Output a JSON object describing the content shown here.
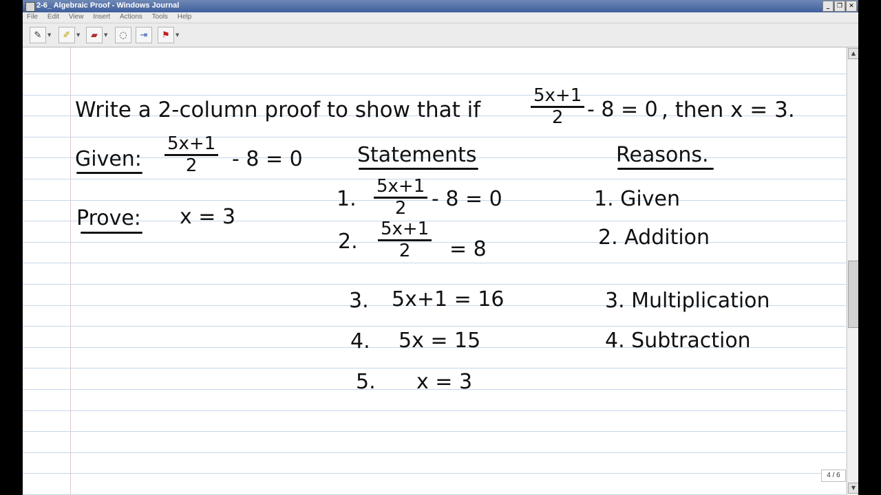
{
  "window": {
    "title": "2-6_ Algebraic Proof - Windows Journal",
    "minimize": "_",
    "restore": "❐",
    "close": "✕"
  },
  "menu": [
    "File",
    "Edit",
    "View",
    "Insert",
    "Actions",
    "Tools",
    "Help"
  ],
  "toolbar": {
    "tools": [
      {
        "name": "pen-tool",
        "glyph": "✎"
      },
      {
        "name": "highlighter-tool",
        "glyph": "✐"
      },
      {
        "name": "eraser-tool",
        "glyph": "▰"
      },
      {
        "name": "lasso-select-tool",
        "glyph": "◌"
      },
      {
        "name": "insert-space-tool",
        "glyph": "⇥"
      },
      {
        "name": "flag-tool",
        "glyph": "⚑"
      }
    ]
  },
  "note": {
    "heading": {
      "prefix": "Write a 2-column proof to show that if",
      "frac_num": "5x+1",
      "frac_den": "2",
      "frac_rest": "- 8 = 0",
      "suffix": ", then x = 3."
    },
    "given": {
      "label": "Given:",
      "frac_num": "5x+1",
      "frac_den": "2",
      "rest": "- 8 = 0"
    },
    "prove": {
      "label": "Prove:",
      "value": "x = 3"
    },
    "statements_header": "Statements",
    "reasons_header": "Reasons.",
    "rows": [
      {
        "num": "1.",
        "frac_num": "5x+1",
        "frac_den": "2",
        "rest": "- 8 = 0",
        "reason": "1. Given"
      },
      {
        "num": "2.",
        "frac_num": "5x+1",
        "frac_den": "2",
        "rest": "= 8",
        "reason": "2. Addition"
      },
      {
        "num": "3.",
        "statement": "5x+1 = 16",
        "reason": "3. Multiplication"
      },
      {
        "num": "4.",
        "statement": "5x = 15",
        "reason": "4. Subtraction"
      },
      {
        "num": "5.",
        "statement": "x = 3"
      }
    ]
  },
  "status": {
    "page_indicator": "4 / 6"
  }
}
